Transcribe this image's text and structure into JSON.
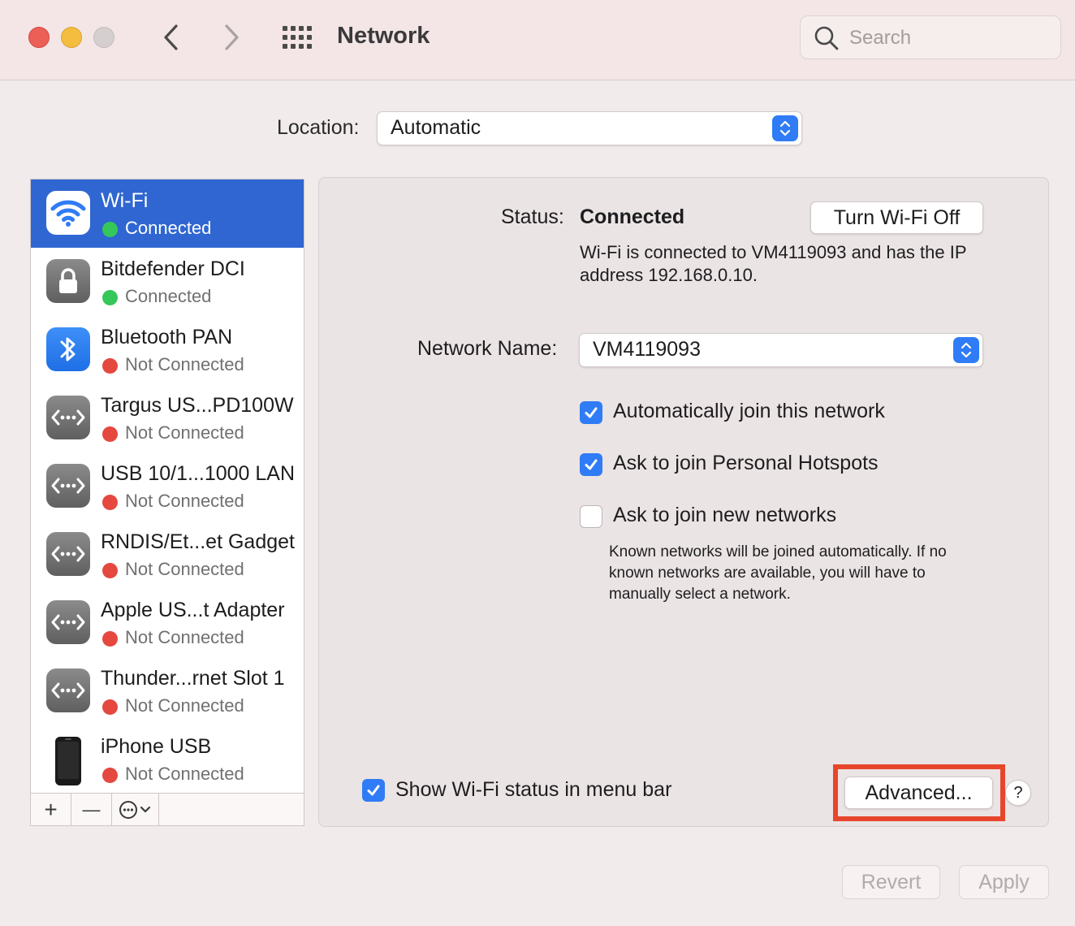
{
  "window": {
    "title": "Network",
    "search_placeholder": "Search"
  },
  "location": {
    "label": "Location:",
    "value": "Automatic"
  },
  "services": [
    {
      "name": "Wi-Fi",
      "status": "Connected",
      "status_color": "green",
      "icon": "wifi-icon",
      "selected": true
    },
    {
      "name": "Bitdefender DCI",
      "status": "Connected",
      "status_color": "green",
      "icon": "lock-icon"
    },
    {
      "name": "Bluetooth PAN",
      "status": "Not Connected",
      "status_color": "red",
      "icon": "bluetooth-icon"
    },
    {
      "name": "Targus US...PD100W",
      "status": "Not Connected",
      "status_color": "red",
      "icon": "ethernet-icon"
    },
    {
      "name": "USB 10/1...1000 LAN",
      "status": "Not Connected",
      "status_color": "red",
      "icon": "ethernet-icon"
    },
    {
      "name": "RNDIS/Et...et Gadget",
      "status": "Not Connected",
      "status_color": "red",
      "icon": "ethernet-icon"
    },
    {
      "name": "Apple US...t Adapter",
      "status": "Not Connected",
      "status_color": "red",
      "icon": "ethernet-icon"
    },
    {
      "name": "Thunder...rnet Slot 1",
      "status": "Not Connected",
      "status_color": "red",
      "icon": "ethernet-icon"
    },
    {
      "name": "iPhone USB",
      "status": "Not Connected",
      "status_color": "red",
      "icon": "iphone-icon"
    }
  ],
  "sidebar_toolbar": {
    "add": "+",
    "remove": "—"
  },
  "detail": {
    "status_label": "Status:",
    "status_value": "Connected",
    "turn_off_button": "Turn Wi-Fi Off",
    "status_description": "Wi-Fi is connected to VM4119093 and has the IP address 192.168.0.10.",
    "network_name_label": "Network Name:",
    "network_name_value": "VM4119093",
    "auto_join_label": "Automatically join this network",
    "auto_join_checked": true,
    "hotspots_label": "Ask to join Personal Hotspots",
    "hotspots_checked": true,
    "new_networks_label": "Ask to join new networks",
    "new_networks_checked": false,
    "new_networks_description": "Known networks will be joined automatically. If no known networks are available, you will have to manually select a network.",
    "show_status_label": "Show Wi-Fi status in menu bar",
    "show_status_checked": true,
    "advanced_button": "Advanced...",
    "help_button": "?"
  },
  "footer": {
    "revert": "Revert",
    "apply": "Apply"
  },
  "colors": {
    "accent": "#2f7cf6",
    "selection": "#2f66d1",
    "highlight_box": "#e7462c",
    "connected": "#35c759",
    "not_connected": "#e5483f"
  }
}
